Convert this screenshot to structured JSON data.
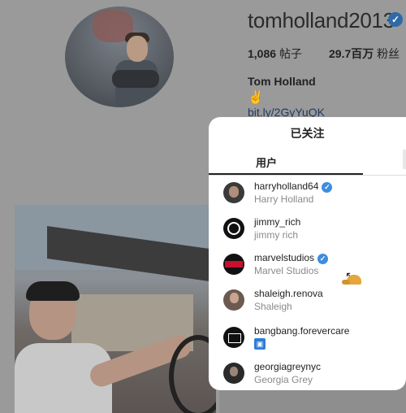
{
  "profile": {
    "username": "tomholland2013",
    "posts_count": "1,086",
    "posts_label": "帖子",
    "followers_count": "29.7百万",
    "followers_label": "粉丝",
    "full_name": "Tom Holland",
    "bio_emoji": "✌",
    "bio_link": "bit.ly/2GyYuQK"
  },
  "sheet": {
    "title": "已关注",
    "tab_users": "用户",
    "following": [
      {
        "handle": "harryholland64",
        "name": "Harry Holland",
        "verified": true
      },
      {
        "handle": "jimmy_rich",
        "name": "jimmy rich",
        "verified": false
      },
      {
        "handle": "marvelstudios",
        "name": "Marvel Studios",
        "verified": true
      },
      {
        "handle": "shaleigh.renova",
        "name": "Shaleigh",
        "verified": false
      },
      {
        "handle": "bangbang.forevercare",
        "name": "",
        "verified": false
      },
      {
        "handle": "georgiagreynyc",
        "name": "Georgia Grey",
        "verified": false
      }
    ]
  },
  "colors": {
    "verified_blue": "#3d8de0",
    "overlay_gray": "#9a9a9a",
    "sheet_bg": "#ffffff"
  }
}
